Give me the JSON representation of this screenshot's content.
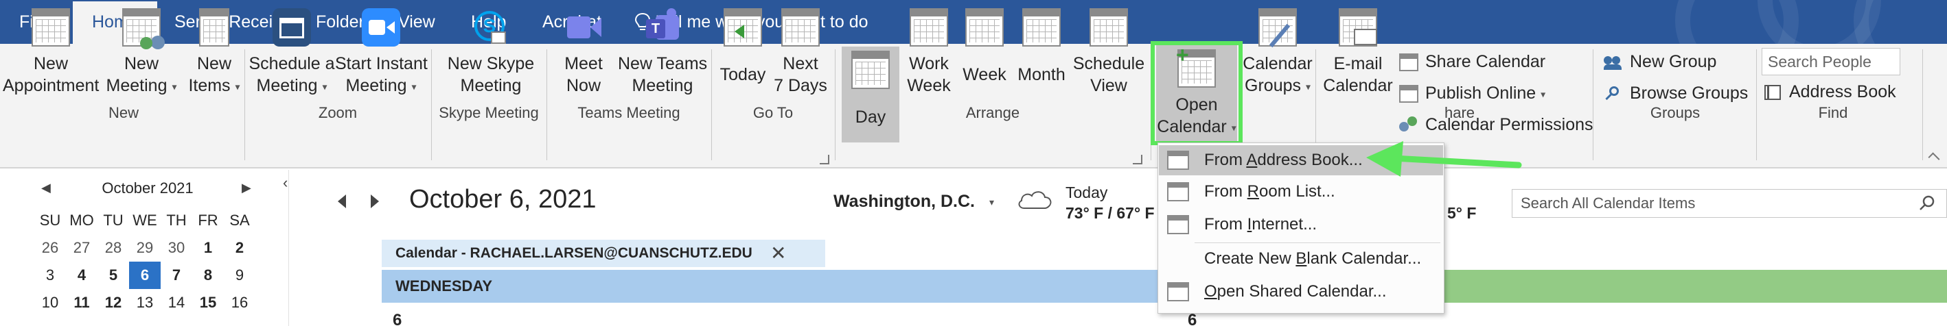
{
  "menubar": {
    "items": [
      "File",
      "Home",
      "Send / Receive",
      "Folder",
      "View",
      "Help",
      "Acrobat"
    ],
    "tell_me": "Tell me what you want to do"
  },
  "ribbon": {
    "new": {
      "appointment": [
        "New",
        "Appointment"
      ],
      "meeting": [
        "New",
        "Meeting"
      ],
      "items": [
        "New",
        "Items"
      ],
      "label": "New"
    },
    "zoom": {
      "schedule": [
        "Schedule a",
        "Meeting"
      ],
      "instant": [
        "Start Instant",
        "Meeting"
      ],
      "label": "Zoom"
    },
    "skype": {
      "button": [
        "New Skype",
        "Meeting"
      ],
      "label": "Skype Meeting"
    },
    "teams": {
      "meet_now": [
        "Meet",
        "Now"
      ],
      "new_teams": [
        "New Teams",
        "Meeting"
      ],
      "label": "Teams Meeting"
    },
    "goto": {
      "today": "Today",
      "next7": [
        "Next",
        "7 Days"
      ],
      "label": "Go To"
    },
    "arrange": {
      "day": "Day",
      "work_week": [
        "Work",
        "Week"
      ],
      "week": "Week",
      "month": "Month",
      "schedule_view": [
        "Schedule",
        "View"
      ],
      "label": "Arrange"
    },
    "manage": {
      "open_calendar": [
        "Open",
        "Calendar"
      ],
      "calendar_groups": [
        "Calendar",
        "Groups"
      ],
      "label_fragment": "hare"
    },
    "share": {
      "email_calendar": [
        "E-mail",
        "Calendar"
      ],
      "share_calendar": "Share Calendar",
      "publish_online": "Publish Online",
      "calendar_permissions": "Calendar Permissions"
    },
    "groups": {
      "new_group": "New Group",
      "browse_groups": "Browse Groups",
      "label": "Groups"
    },
    "find": {
      "search_people_placeholder": "Search People",
      "address_book": "Address Book",
      "label": "Find"
    }
  },
  "dropdown": {
    "items": [
      {
        "pre": "From ",
        "u": "A",
        "post": "ddress Book...",
        "hover": true
      },
      {
        "pre": "From ",
        "u": "R",
        "post": "oom List...",
        "hover": false
      },
      {
        "pre": "From ",
        "u": "I",
        "post": "nternet...",
        "hover": false
      },
      {
        "pre": "Create New ",
        "u": "B",
        "post": "lank Calendar...",
        "hover": false
      },
      {
        "pre": "",
        "u": "O",
        "post": "pen Shared Calendar...",
        "hover": false
      }
    ]
  },
  "mini_calendar": {
    "title": "October 2021",
    "weekdays": [
      "SU",
      "MO",
      "TU",
      "WE",
      "TH",
      "FR",
      "SA"
    ],
    "weeks": [
      [
        {
          "d": "26",
          "s": "dim"
        },
        {
          "d": "27",
          "s": "dim"
        },
        {
          "d": "28",
          "s": "dim"
        },
        {
          "d": "29",
          "s": "dim"
        },
        {
          "d": "30",
          "s": "dim"
        },
        {
          "d": "1",
          "s": "bold"
        },
        {
          "d": "2",
          "s": "bold"
        }
      ],
      [
        {
          "d": "3",
          "s": ""
        },
        {
          "d": "4",
          "s": "bold"
        },
        {
          "d": "5",
          "s": "bold"
        },
        {
          "d": "6",
          "s": "today"
        },
        {
          "d": "7",
          "s": "bold"
        },
        {
          "d": "8",
          "s": "bold"
        },
        {
          "d": "9",
          "s": ""
        }
      ],
      [
        {
          "d": "10",
          "s": ""
        },
        {
          "d": "11",
          "s": "bold"
        },
        {
          "d": "12",
          "s": "bold"
        },
        {
          "d": "13",
          "s": ""
        },
        {
          "d": "14",
          "s": ""
        },
        {
          "d": "15",
          "s": "bold"
        },
        {
          "d": "16",
          "s": ""
        }
      ]
    ]
  },
  "calendar_view": {
    "date": "October 6, 2021",
    "location": "Washington, D.C.",
    "weather_label": "Today",
    "weather_temp": "73° F / 67° F",
    "weather_temp_fragment": "5° F",
    "search_placeholder": "Search All Calendar Items",
    "calendar_tab": "Calendar - RACHAEL.LARSEN@CUANSCHUTZ.EDU",
    "day_name": "WEDNESDAY",
    "day_number": "6"
  },
  "colors": {
    "menubar": "#2b579a",
    "highlight_box": "#5ce65c",
    "today_cell": "#2b72c6",
    "day_header": "#a8cbed",
    "other_calendar_header": "#93cb85"
  }
}
